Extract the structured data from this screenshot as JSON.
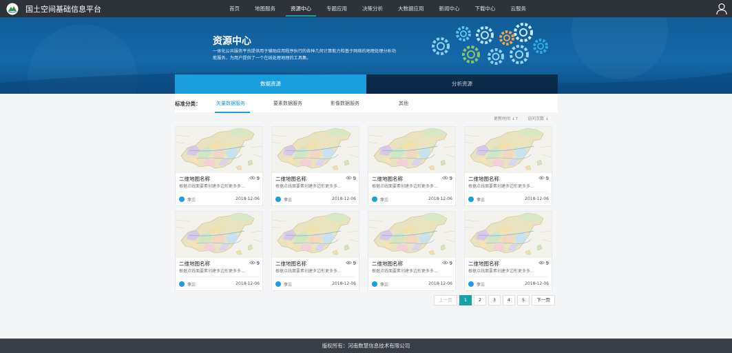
{
  "header": {
    "brand": "国土空间基础信息平台",
    "nav": [
      "首页",
      "地图服务",
      "资源中心",
      "专题应用",
      "决策分析",
      "大数据应用",
      "新闻中心",
      "下载中心",
      "云服务"
    ],
    "active_index": 2,
    "logo_icon": "platform-logo-icon",
    "user_icon": "user-icon"
  },
  "banner": {
    "title": "资源中心",
    "description": "一体化公共服务平台提供用于辅助应用程序执行的各种几何计算能力和基于网络的地理处理分析功能服务，为用户提供了一个在线处理地理的工具集。",
    "tabs": [
      "数据资源",
      "分析资源"
    ],
    "active_tab": 0,
    "decoration": "gears-illustration"
  },
  "filter": {
    "label": "标准分类：",
    "tabs": [
      "矢量数据服务",
      "要素数据服务",
      "影像数据服务",
      "其他"
    ],
    "active_tab": 0
  },
  "sort": {
    "update_time": "更新时间 ↓↑",
    "visits": "访问次数 ↓"
  },
  "cards": [
    {
      "name": "二维地图名称",
      "views": "9",
      "desc": "根据点线面要素创建多边形更多多...",
      "author": "李三",
      "date": "2018-12-06"
    },
    {
      "name": "二维地图名称",
      "views": "9",
      "desc": "根据点线面要素创建多边形更多多...",
      "author": "李三",
      "date": "2018-12-06"
    },
    {
      "name": "二维地图名称",
      "views": "9",
      "desc": "根据点线面要素创建多边形更多多...",
      "author": "李三",
      "date": "2018-12-06"
    },
    {
      "name": "二维地图名称",
      "views": "9",
      "desc": "根据点线面要素创建多边形更多多...",
      "author": "李三",
      "date": "2018-12-06"
    },
    {
      "name": "二维地图名称",
      "views": "9",
      "desc": "根据点线面要素创建多边形更多多...",
      "author": "李三",
      "date": "2018-12-06"
    },
    {
      "name": "二维地图名称",
      "views": "9",
      "desc": "根据点线面要素创建多边形更多多...",
      "author": "李三",
      "date": "2018-12-06"
    },
    {
      "name": "二维地图名称",
      "views": "9",
      "desc": "根据点线面要素创建多边形更多多...",
      "author": "李三",
      "date": "2018-12-06"
    },
    {
      "name": "二维地图名称",
      "views": "9",
      "desc": "根据点线面要素创建多边形更多多...",
      "author": "李三",
      "date": "2018-12-06"
    }
  ],
  "card_icons": {
    "thumbnail": "china-map-thumbnail",
    "views": "eye-icon",
    "author": "user-avatar-icon"
  },
  "pagination": {
    "prev": "上一页",
    "pages": [
      "1",
      "2",
      "3",
      "4",
      "5"
    ],
    "active": "1",
    "next": "下一页"
  },
  "footer": {
    "copyright": "版权所有：河南数慧信息技术有限公司"
  },
  "colors": {
    "topbar": "#2e3339",
    "accent": "#1a9ede",
    "teal": "#17a3a3",
    "banner": "#1468a8",
    "footer": "#3a3f47"
  }
}
